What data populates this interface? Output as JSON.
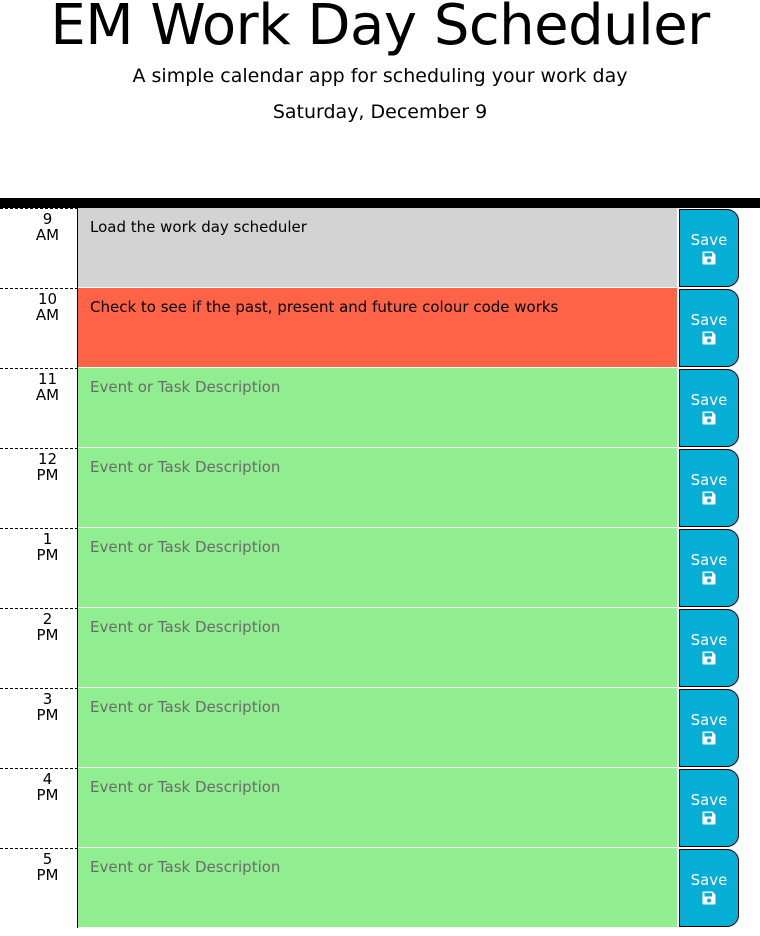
{
  "header": {
    "title": "EM Work Day Scheduler",
    "lead": "A simple calendar app for scheduling your work day",
    "current_day": "Saturday, December 9"
  },
  "colors": {
    "past": "#d3d3d3",
    "present": "#ff6347",
    "future": "#90ee90",
    "save_button": "#06aed5"
  },
  "save_label": "Save",
  "save_icon": "floppy-disk-icon",
  "time_blocks": [
    {
      "hour": "9",
      "period": "AM",
      "text": "Load the work day scheduler",
      "placeholder": "Event or Task Description",
      "state": "past"
    },
    {
      "hour": "10",
      "period": "AM",
      "text": "Check to see if the past, present and future colour code works",
      "placeholder": "Event or Task Description",
      "state": "present"
    },
    {
      "hour": "11",
      "period": "AM",
      "text": "",
      "placeholder": "Event or Task Description",
      "state": "future"
    },
    {
      "hour": "12",
      "period": "PM",
      "text": "",
      "placeholder": "Event or Task Description",
      "state": "future"
    },
    {
      "hour": "1",
      "period": "PM",
      "text": "",
      "placeholder": "Event or Task Description",
      "state": "future"
    },
    {
      "hour": "2",
      "period": "PM",
      "text": "",
      "placeholder": "Event or Task Description",
      "state": "future"
    },
    {
      "hour": "3",
      "period": "PM",
      "text": "",
      "placeholder": "Event or Task Description",
      "state": "future"
    },
    {
      "hour": "4",
      "period": "PM",
      "text": "",
      "placeholder": "Event or Task Description",
      "state": "future"
    },
    {
      "hour": "5",
      "period": "PM",
      "text": "",
      "placeholder": "Event or Task Description",
      "state": "future"
    }
  ]
}
